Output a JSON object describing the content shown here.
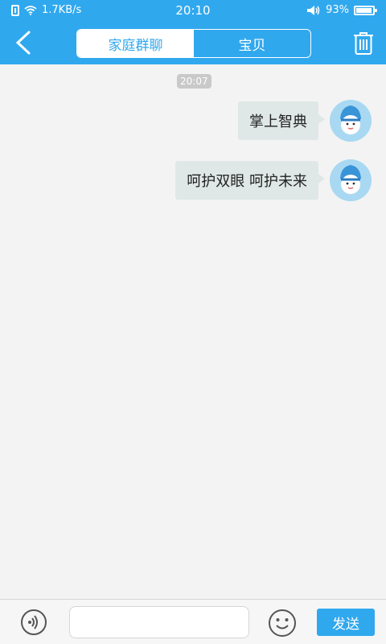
{
  "status_bar": {
    "network_speed": "1.7KB/s",
    "time": "20:10",
    "battery": "93%"
  },
  "nav": {
    "tabs": [
      {
        "label": "家庭群聊",
        "active": true
      },
      {
        "label": "宝贝",
        "active": false
      }
    ]
  },
  "chat": {
    "timestamp": "20:07",
    "messages": [
      {
        "text": "掌上智典"
      },
      {
        "text": "呵护双眼 呵护未来"
      }
    ]
  },
  "input": {
    "value": "",
    "send_label": "发送"
  },
  "colors": {
    "primary": "#30a8ee",
    "bubble": "#dfe8e6",
    "background": "#f4f3f3"
  }
}
